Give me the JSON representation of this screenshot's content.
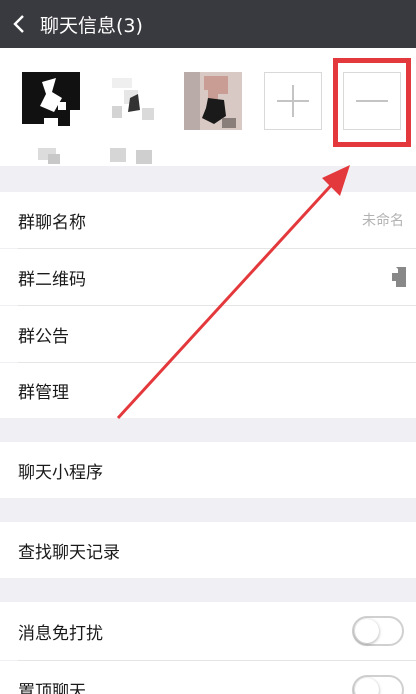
{
  "header": {
    "title": "聊天信息(3)",
    "back_icon": "chevron-left-icon"
  },
  "members": {
    "add_icon": "plus-icon",
    "remove_icon": "minus-icon"
  },
  "settings": {
    "group_name_label": "群聊名称",
    "group_name_value": "未命名",
    "qr_label": "群二维码",
    "notice_label": "群公告",
    "manage_label": "群管理",
    "mini_program_label": "聊天小程序",
    "search_history_label": "查找聊天记录",
    "mute_label": "消息免打扰",
    "pin_label": "置顶聊天"
  },
  "colors": {
    "annotation": "#e4393c",
    "header_bg": "#393a3f",
    "page_bg": "#efeff4"
  }
}
